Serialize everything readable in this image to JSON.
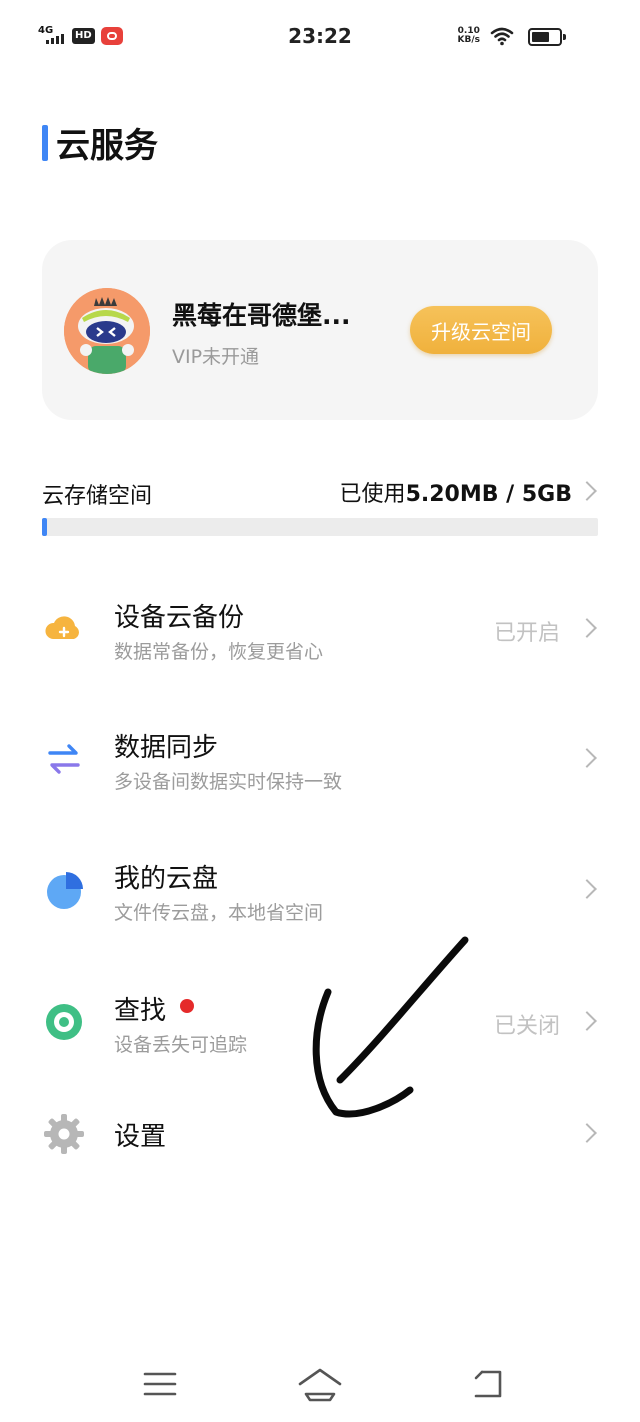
{
  "status_bar": {
    "network": "4G",
    "hd_badge": "HD",
    "time": "23:22",
    "speed_value": "0.10",
    "speed_unit": "KB/s"
  },
  "page": {
    "title": "云服务"
  },
  "account": {
    "name": "黑莓在哥德堡...",
    "vip_status": "VIP未开通",
    "upgrade_label": "升级云空间"
  },
  "storage": {
    "label": "云存储空间",
    "used_prefix": "已使用",
    "used_value": "5.20MB / 5GB",
    "used_fraction": 0.001
  },
  "menu": {
    "items": [
      {
        "title": "设备云备份",
        "subtitle": "数据常备份，恢复更省心",
        "state": "已开启",
        "icon": "cloud-icon"
      },
      {
        "title": "数据同步",
        "subtitle": "多设备间数据实时保持一致",
        "state": "",
        "icon": "sync-icon"
      },
      {
        "title": "我的云盘",
        "subtitle": "文件传云盘，本地省空间",
        "state": "",
        "icon": "pie-chart-icon"
      },
      {
        "title": "查找",
        "subtitle": "设备丢失可追踪",
        "state": "已关闭",
        "icon": "locate-icon"
      },
      {
        "title": "设置",
        "subtitle": "",
        "state": "",
        "icon": "gear-icon"
      }
    ]
  },
  "nav_bar": {
    "buttons": [
      "menu-icon",
      "home-icon",
      "back-icon"
    ]
  },
  "colors": {
    "accent": "#3f86f5",
    "upgrade": "#f2b640",
    "alert_dot": "#e52a2a"
  }
}
